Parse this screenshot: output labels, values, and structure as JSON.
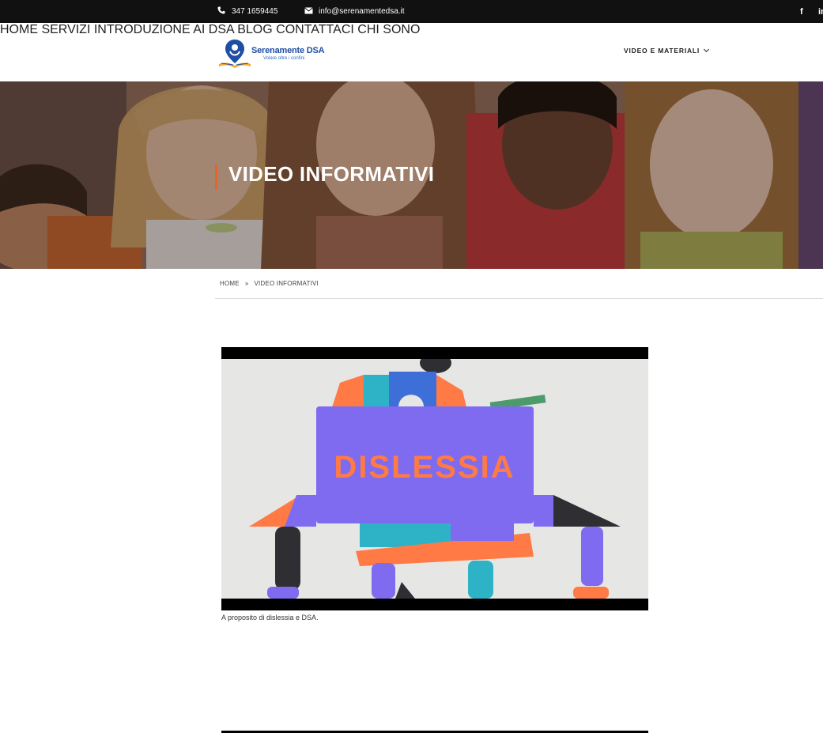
{
  "topbar": {
    "phone": "347 1659445",
    "email": "info@serenamentedsa.it",
    "icons": [
      "phone-icon",
      "envelope-icon",
      "facebook-icon",
      "linkedin-icon"
    ],
    "facebook_glyph": "f",
    "linkedin_glyph": "in"
  },
  "logo": {
    "title": "Serenamente DSA",
    "subtitle": "Volare oltre i confini"
  },
  "nav": {
    "items": [
      "HOME",
      "SERVIZI",
      "INTRODUZIONE AI DSA",
      "BLOG",
      "VIDEO E MATERIALI",
      "CONTATTACI",
      "CHI SONO"
    ]
  },
  "hero": {
    "title": "VIDEO INFORMATIVI",
    "accent_color": "#e8622c"
  },
  "breadcrumb": {
    "home": "HOME",
    "separator": "»",
    "current": "VIDEO INFORMATIVI"
  },
  "video": {
    "thumbnail_text": "DISLESSIA",
    "caption": "A proposito di dislessia e DSA."
  },
  "colors": {
    "topbar_bg": "#111111",
    "brand_blue": "#1f4fa3",
    "accent": "#e8622c"
  }
}
